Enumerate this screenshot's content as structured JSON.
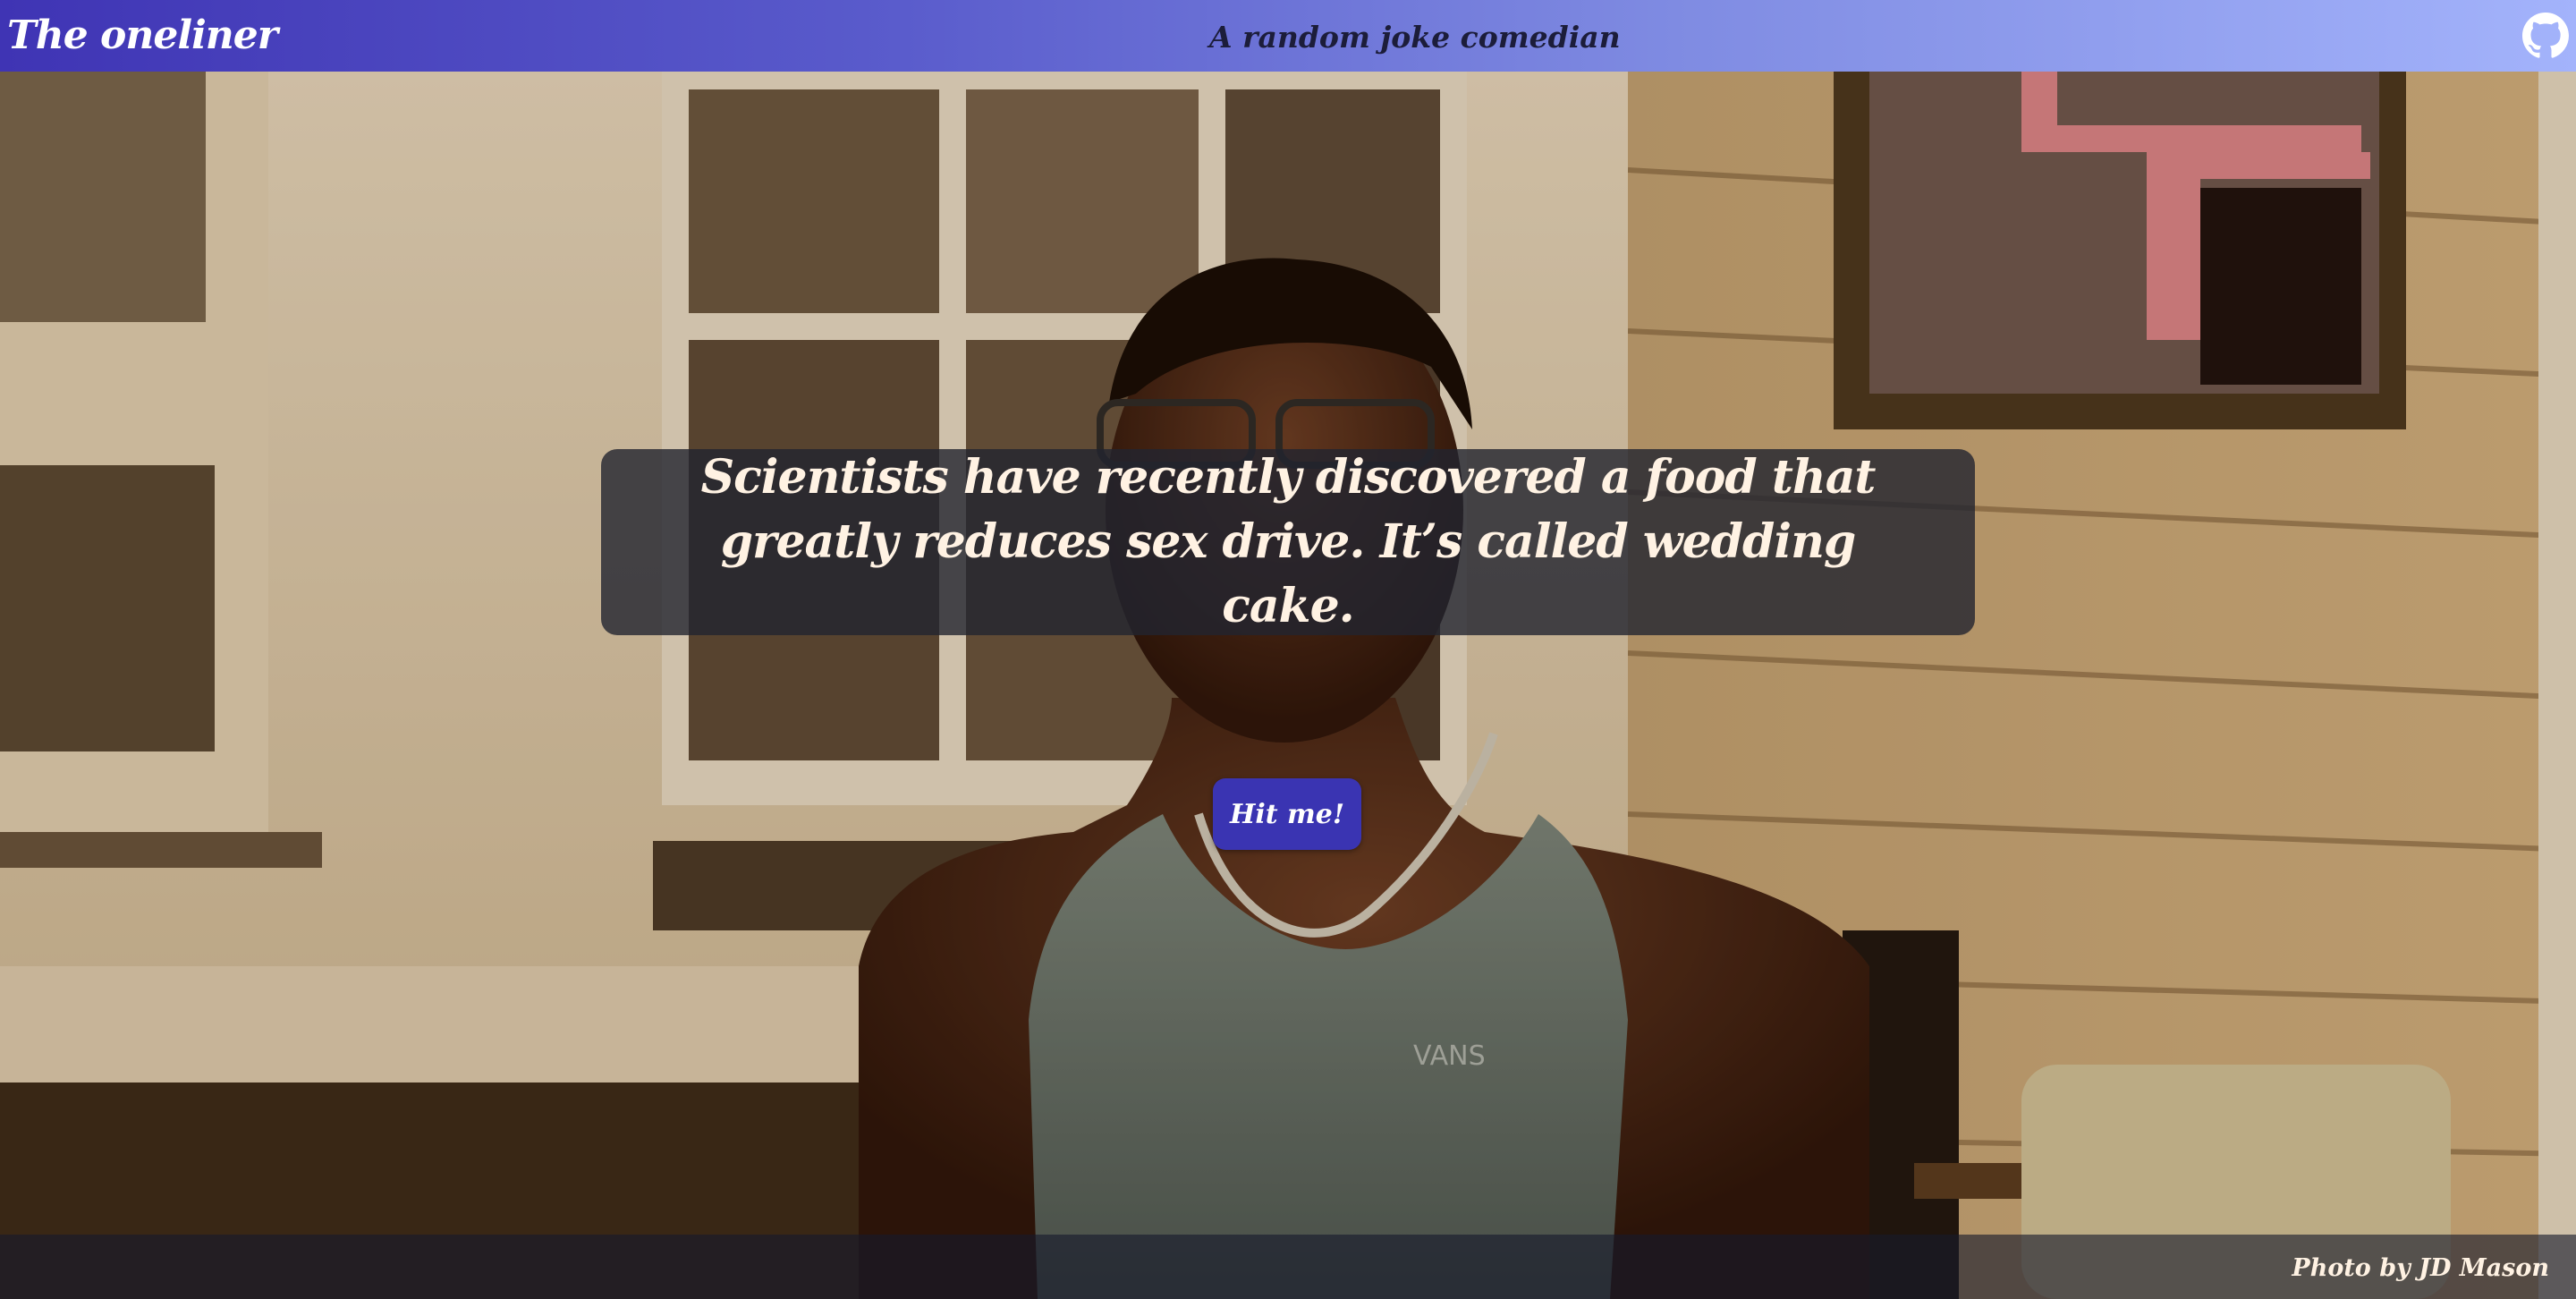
{
  "header": {
    "brand": "The oneliner",
    "tagline": "A random joke comedian",
    "github_icon": "github-icon",
    "gradient_start": "#3f34b4",
    "gradient_end": "#a3b3fb"
  },
  "joke": {
    "text": "Scientists have recently discovered a food that greatly reduces sex drive. It’s called wedding cake."
  },
  "actions": {
    "hit_label": "Hit me!",
    "button_color": "#3a34b2"
  },
  "footer": {
    "credit": "Photo by JD Mason"
  }
}
